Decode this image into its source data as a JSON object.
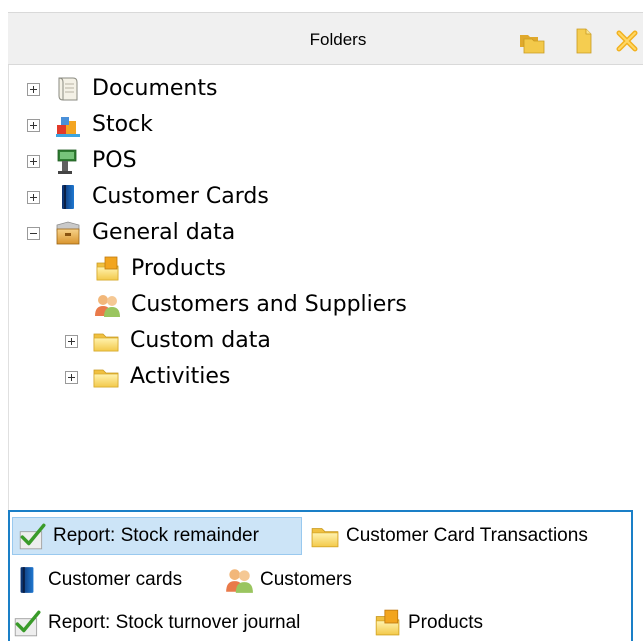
{
  "header": {
    "title": "Folders"
  },
  "icons": {
    "header_new_folder": "folder-stack-icon",
    "header_add": "add-folder-icon",
    "header_delete": "delete-icon"
  },
  "tree": {
    "items": [
      {
        "label": "Documents",
        "icon": "document-scroll-icon",
        "expander": "plus"
      },
      {
        "label": "Stock",
        "icon": "stock-boxes-icon",
        "expander": "plus"
      },
      {
        "label": "POS",
        "icon": "pos-terminal-icon",
        "expander": "plus"
      },
      {
        "label": "Customer Cards",
        "icon": "card-icon",
        "expander": "plus"
      },
      {
        "label": "General data",
        "icon": "box-icon",
        "expander": "minus"
      },
      {
        "label": "Products",
        "icon": "products-folder-icon",
        "expander": "none"
      },
      {
        "label": "Customers and Suppliers",
        "icon": "people-icon",
        "expander": "none"
      },
      {
        "label": "Custom data",
        "icon": "folder-icon",
        "expander": "plus"
      },
      {
        "label": "Activities",
        "icon": "folder-icon",
        "expander": "plus"
      }
    ]
  },
  "quick": {
    "items": [
      {
        "label": "Report: Stock remainder",
        "icon": "report-check-icon",
        "selected": true
      },
      {
        "label": "Customer Card Transactions",
        "icon": "folder-icon",
        "selected": false
      },
      {
        "label": "Customer cards",
        "icon": "card-icon",
        "selected": false
      },
      {
        "label": "Customers",
        "icon": "people-icon",
        "selected": false
      },
      {
        "label": "Report: Stock turnover journal",
        "icon": "report-check-icon",
        "selected": false
      },
      {
        "label": "Products",
        "icon": "products-folder-icon",
        "selected": false
      }
    ]
  }
}
